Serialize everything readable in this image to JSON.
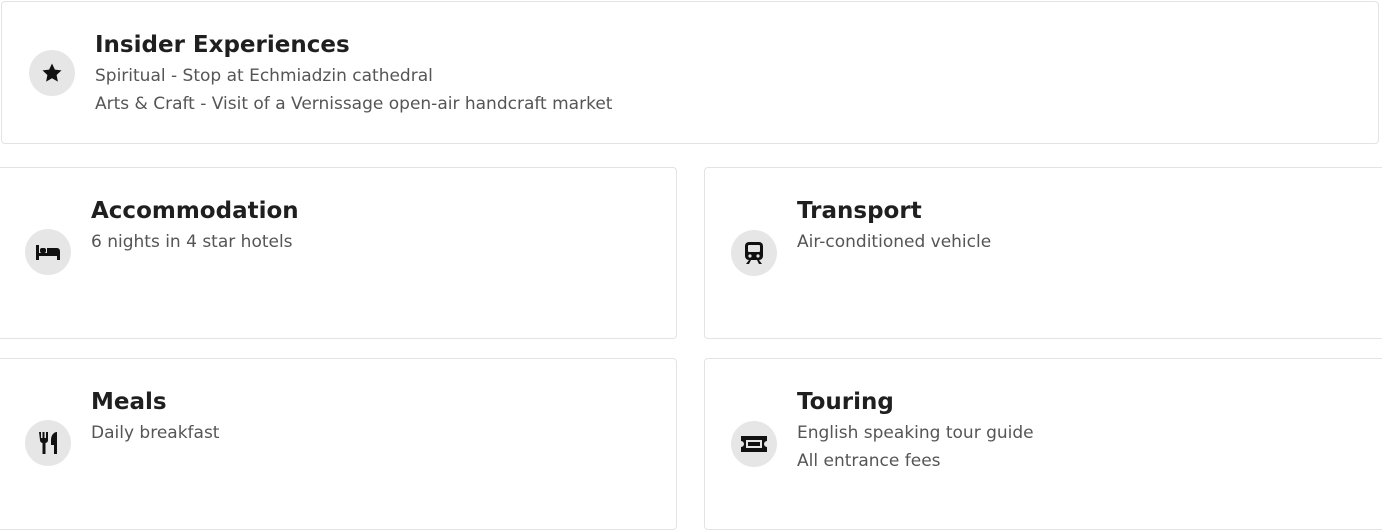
{
  "insider": {
    "title": "Insider Experiences",
    "icon": "star-icon",
    "lines": [
      "Spiritual - Stop at Echmiadzin cathedral",
      "Arts & Craft - Visit of a Vernissage open-air handcraft market"
    ]
  },
  "accommodation": {
    "title": "Accommodation",
    "icon": "bed-icon",
    "lines": [
      "6 nights in 4 star hotels"
    ]
  },
  "transport": {
    "title": "Transport",
    "icon": "train-icon",
    "lines": [
      "Air-conditioned vehicle"
    ]
  },
  "meals": {
    "title": "Meals",
    "icon": "utensils-icon",
    "lines": [
      "Daily breakfast"
    ]
  },
  "touring": {
    "title": "Touring",
    "icon": "ticket-icon",
    "lines": [
      "English speaking tour guide",
      "All entrance fees"
    ]
  },
  "colors": {
    "icon_background": "#e6e6e6",
    "title_text": "#1f1f1f",
    "body_text": "#555555",
    "card_border": "#e3e3e3"
  }
}
